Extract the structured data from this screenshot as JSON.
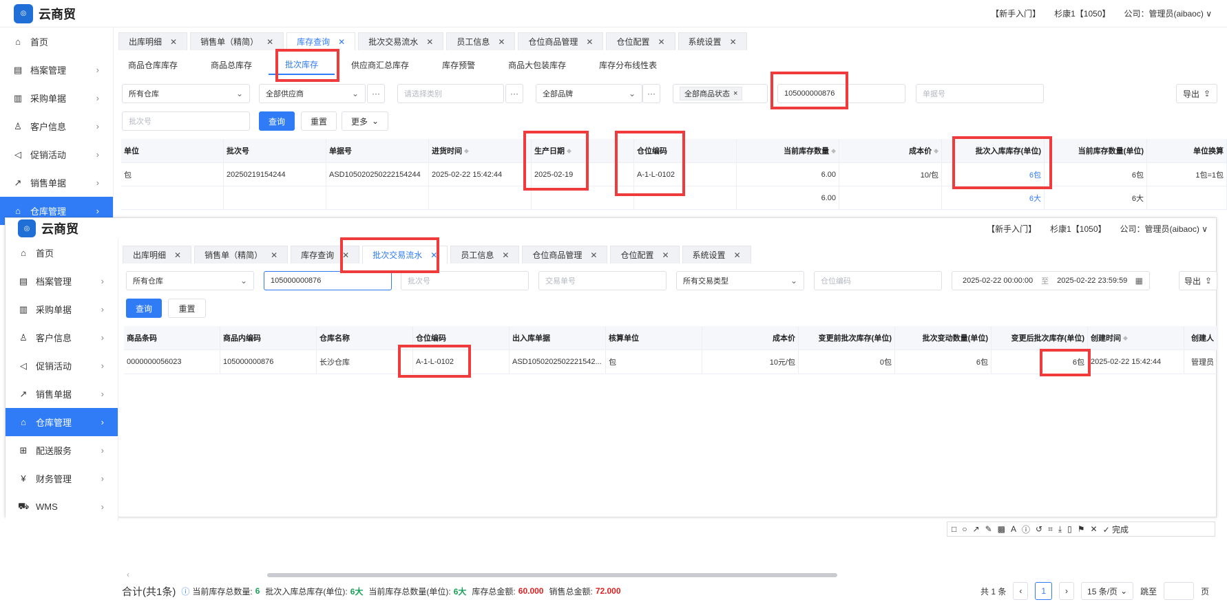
{
  "app": {
    "name": "云商贸",
    "logo_text": "云商贸"
  },
  "top": {
    "guide": "【新手入门】",
    "user": "杉康1【1050】",
    "company": "公司：管理员(aibaoc)"
  },
  "sidebar": {
    "back": [
      "首页",
      "档案管理",
      "采购单据",
      "客户信息",
      "促销活动",
      "销售单据",
      "仓库管理"
    ],
    "front": [
      "首页",
      "档案管理",
      "采购单据",
      "客户信息",
      "促销活动",
      "销售单据",
      "仓库管理",
      "配送服务",
      "财务管理",
      "WMS"
    ]
  },
  "back": {
    "tabs": [
      "出库明细",
      "销售单（精简）",
      "库存查询",
      "批次交易流水",
      "员工信息",
      "仓位商品管理",
      "仓位配置",
      "系统设置"
    ],
    "subtabs": [
      "商品仓库库存",
      "商品总库存",
      "批次库存",
      "供应商汇总库存",
      "库存预警",
      "商品大包装库存",
      "库存分布线性表"
    ],
    "filters": {
      "warehouse": "所有仓库",
      "supplier": "全部供应商",
      "category_ph": "请选择类别",
      "brand": "全部品牌",
      "status": "全部商品状态",
      "code": "105000000876",
      "docno_ph": "单据号",
      "batch_ph": "批次号",
      "export": "导出",
      "query": "查询",
      "reset": "重置",
      "more": "更多"
    },
    "headers": [
      "单位",
      "批次号",
      "单据号",
      "进货时间",
      "生产日期",
      "仓位编码",
      "当前库存数量",
      "成本价",
      "批次入库库存(单位)",
      "当前库存数量(单位)",
      "单位换算"
    ],
    "rows": [
      [
        "包",
        "20250219154244",
        "ASD105020250222154244",
        "2025-02-22 15:42:44",
        "2025-02-19",
        "A-1-L-0102",
        "6.00",
        "10/包",
        "6包",
        "6包",
        "1包=1包"
      ],
      [
        "",
        "",
        "",
        "",
        "",
        "",
        "6.00",
        "",
        "6大",
        "6大",
        ""
      ]
    ]
  },
  "front": {
    "tabs": [
      "出库明细",
      "销售单（精简）",
      "库存查询",
      "批次交易流水",
      "员工信息",
      "仓位商品管理",
      "仓位配置",
      "系统设置"
    ],
    "filters": {
      "warehouse": "所有仓库",
      "code": "105000000876",
      "batch_ph": "批次号",
      "trade_ph": "交易单号",
      "type": "所有交易类型",
      "loc_ph": "仓位编码",
      "date_from": "2025-02-22 00:00:00",
      "date_sep": "至",
      "date_to": "2025-02-22 23:59:59",
      "export": "导出",
      "query": "查询",
      "reset": "重置"
    },
    "headers": [
      "商品条码",
      "商品内编码",
      "仓库名称",
      "仓位编码",
      "出入库单据",
      "核算单位",
      "成本价",
      "变更前批次库存(单位)",
      "批次变动数量(单位)",
      "变更后批次库存(单位)",
      "创建时间",
      "创建人"
    ],
    "row": [
      "0000000056023",
      "105000000876",
      "长沙仓库",
      "A-1-L-0102",
      "ASD1050202502221542...",
      "包",
      "10元/包",
      "0包",
      "6包",
      "6包",
      "2025-02-22 15:42:44",
      "管理员"
    ]
  },
  "annotation_toolbar": {
    "done": "完成"
  },
  "footer": {
    "total": "合计(共1条)",
    "l1": "当前库存总数量:",
    "v1": "6",
    "l2": "批次入库总库存(单位):",
    "v2": "6大",
    "l3": "当前库存总数量(单位):",
    "v3": "6大",
    "l4": "库存总金额:",
    "v4": "60.000",
    "l5": "销售总金额:",
    "v5": "72.000",
    "count": "共 1 条",
    "page": "1",
    "page_size": "15 条/页",
    "goto": "跳至",
    "page_unit": "页"
  },
  "colors": {
    "accent": "#2f7cf6",
    "highlight": "#ef3b3b"
  }
}
